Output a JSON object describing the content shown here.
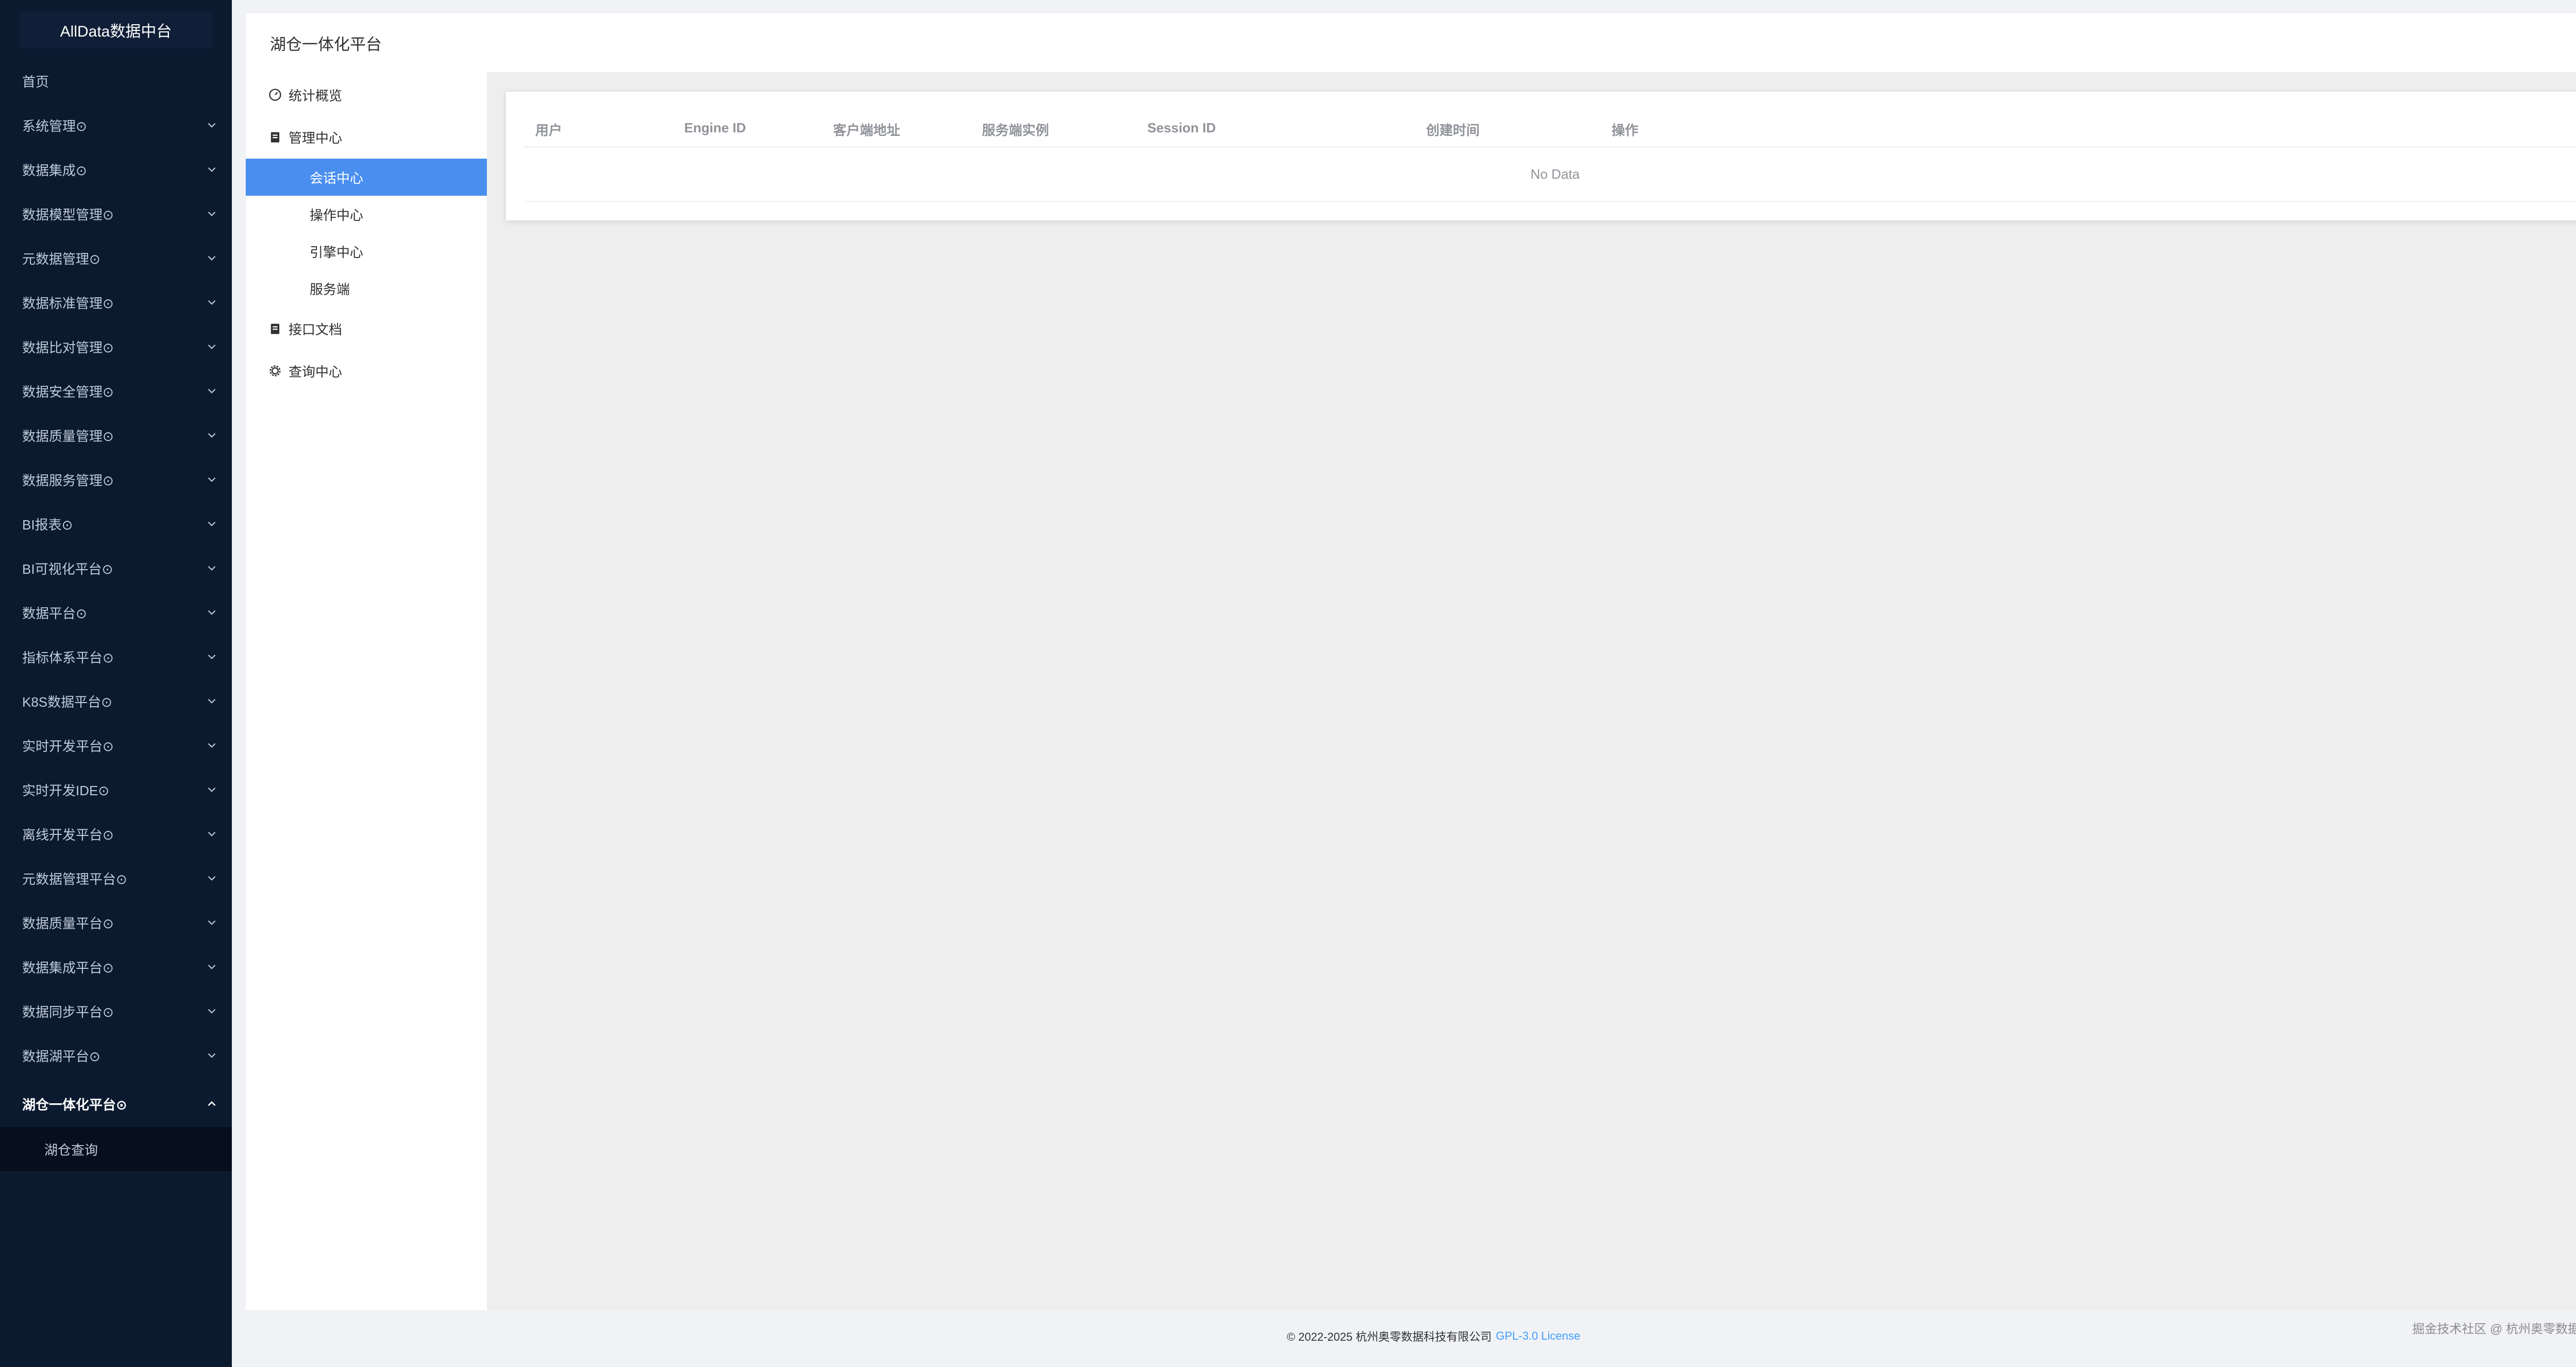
{
  "app": {
    "logo_text": "AllData数据中台"
  },
  "sidebar": {
    "items": [
      {
        "label": "首页"
      },
      {
        "label": "系统管理⊙"
      },
      {
        "label": "数据集成⊙"
      },
      {
        "label": "数据模型管理⊙"
      },
      {
        "label": "元数据管理⊙"
      },
      {
        "label": "数据标准管理⊙"
      },
      {
        "label": "数据比对管理⊙"
      },
      {
        "label": "数据安全管理⊙"
      },
      {
        "label": "数据质量管理⊙"
      },
      {
        "label": "数据服务管理⊙"
      },
      {
        "label": "BI报表⊙"
      },
      {
        "label": "BI可视化平台⊙"
      },
      {
        "label": "数据平台⊙"
      },
      {
        "label": "指标体系平台⊙"
      },
      {
        "label": "K8S数据平台⊙"
      },
      {
        "label": "实时开发平台⊙"
      },
      {
        "label": "实时开发IDE⊙"
      },
      {
        "label": "离线开发平台⊙"
      },
      {
        "label": "元数据管理平台⊙"
      },
      {
        "label": "数据质量平台⊙"
      },
      {
        "label": "数据集成平台⊙"
      },
      {
        "label": "数据同步平台⊙"
      },
      {
        "label": "数据湖平台⊙"
      },
      {
        "label": "湖仓一体化平台⊙"
      }
    ],
    "active_sub_label": "湖仓查询"
  },
  "header": {
    "title": "湖仓一体化平台"
  },
  "submenu": {
    "overview": "统计概览",
    "manage": "管理中心",
    "manage_children": [
      "会话中心",
      "操作中心",
      "引擎中心",
      "服务端"
    ],
    "api_docs": "接口文档",
    "query": "查询中心"
  },
  "table": {
    "columns": [
      "用户",
      "Engine ID",
      "客户端地址",
      "服务端实例",
      "Session ID",
      "创建时间",
      "操作"
    ],
    "empty_text": "No Data"
  },
  "footer": {
    "copyright": "© 2022-2025 杭州奥零数据科技有限公司",
    "license": "GPL-3.0 License"
  },
  "watermark": "掘金技术社区 @ 杭州奥零数据科技",
  "colors": {
    "sidebar_bg": "#0c1a30",
    "accent": "#4a8ff0",
    "link": "#409eff"
  }
}
